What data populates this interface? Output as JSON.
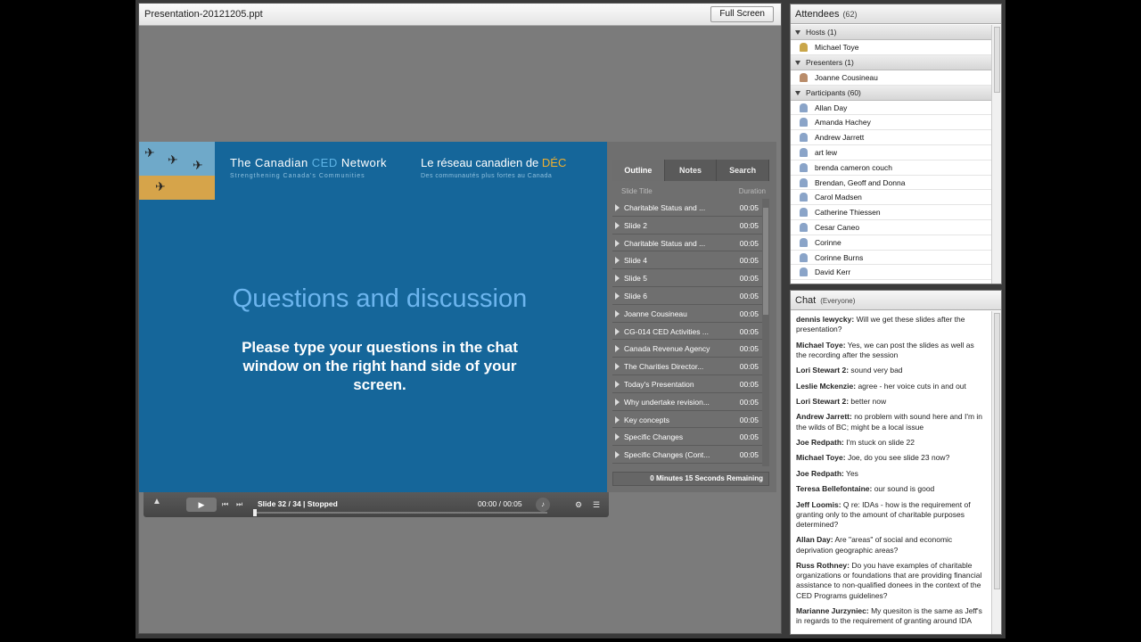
{
  "presentation": {
    "file_title": "Presentation-20121205.ppt",
    "full_screen_label": "Full Screen",
    "slide": {
      "network_en_prefix": "The Canadian ",
      "network_en_ced": "CED",
      "network_en_suffix": " Network",
      "network_fr_prefix": "Le réseau canadien de ",
      "network_fr_dec": "DÉC",
      "tagline_en": "Strengthening Canada's Communities",
      "tagline_fr": "Des communautés plus fortes au Canada",
      "heading": "Questions and discussion",
      "body": "Please type your questions in the chat window on the right hand side of your screen."
    },
    "outline": {
      "tabs": [
        "Outline",
        "Notes",
        "Search"
      ],
      "active_tab": "Outline",
      "col_title": "Slide Title",
      "col_duration": "Duration",
      "rows": [
        {
          "title": "Charitable Status and ...",
          "duration": "00:05"
        },
        {
          "title": "Slide 2",
          "duration": "00:05"
        },
        {
          "title": "Charitable Status and ...",
          "duration": "00:05"
        },
        {
          "title": "Slide 4",
          "duration": "00:05"
        },
        {
          "title": "Slide 5",
          "duration": "00:05"
        },
        {
          "title": "Slide 6",
          "duration": "00:05"
        },
        {
          "title": "Joanne Cousineau",
          "duration": "00:05"
        },
        {
          "title": "CG-014 CED Activities ...",
          "duration": "00:05"
        },
        {
          "title": "Canada Revenue Agency",
          "duration": "00:05"
        },
        {
          "title": "The Charities Director...",
          "duration": "00:05"
        },
        {
          "title": "Today's Presentation",
          "duration": "00:05"
        },
        {
          "title": "Why undertake revision...",
          "duration": "00:05"
        },
        {
          "title": "Key concepts",
          "duration": "00:05"
        },
        {
          "title": "Specific Changes",
          "duration": "00:05"
        },
        {
          "title": "Specific Changes (Cont...",
          "duration": "00:05"
        }
      ],
      "remaining": "0 Minutes 15 Seconds Remaining"
    },
    "controls": {
      "slide_status": "Slide 32 / 34 | Stopped",
      "timecode": "00:00 / 00:05",
      "adobe_label": "Adobe"
    }
  },
  "attendees": {
    "title": "Attendees",
    "count": "(62)",
    "hosts_label": "Hosts (1)",
    "hosts": [
      "Michael Toye"
    ],
    "presenters_label": "Presenters (1)",
    "presenters": [
      "Joanne Cousineau"
    ],
    "participants_label": "Participants (60)",
    "participants": [
      "Allan Day",
      "Amanda Hachey",
      "Andrew Jarrett",
      "art lew",
      "brenda cameron couch",
      "Brendan, Geoff and Donna",
      "Carol Madsen",
      "Catherine Thiessen",
      "Cesar Caneo",
      "Corinne",
      "Corinne Burns",
      "David Kerr"
    ]
  },
  "chat": {
    "title": "Chat",
    "scope": "(Everyone)",
    "messages": [
      {
        "sender": "dennis lewycky:",
        "text": " Will we get these slides after the presentation?"
      },
      {
        "sender": "Michael Toye:",
        "text": " Yes, we can post the slides as well as the recording after the session"
      },
      {
        "sender": "Lori Stewart 2:",
        "text": " sound very bad"
      },
      {
        "sender": "Leslie Mckenzie:",
        "text": " agree - her voice cuts in and out"
      },
      {
        "sender": "Lori Stewart 2:",
        "text": " better now"
      },
      {
        "sender": "Andrew Jarrett:",
        "text": " no problem with sound here and I'm in the wilds of BC; might be a local issue"
      },
      {
        "sender": "Joe Redpath:",
        "text": " I'm stuck on slide 22"
      },
      {
        "sender": "Michael Toye:",
        "text": " Joe, do you see slide 23 now?"
      },
      {
        "sender": "Joe Redpath:",
        "text": " Yes"
      },
      {
        "sender": "Teresa Bellefontaine:",
        "text": " our sound is good"
      },
      {
        "sender": "Jeff Loomis:",
        "text": " Q re: IDAs - how is the requirement of granting only to the amount of charitable purposes determined?"
      },
      {
        "sender": "Allan Day:",
        "text": " Are \"areas\" of social and economic deprivation geographic areas?"
      },
      {
        "sender": "Russ Rothney:",
        "text": " Do you have examples of charitable organizations or foundations that are providing financial assistance to non-qualified donees in the context of the CED Programs guidelines?"
      },
      {
        "sender": "Marianne Jurzyniec:",
        "text": " My quesiton is the same as Jeff's in regards to the requirement of granting around IDA"
      }
    ]
  },
  "colors": {
    "slide_bg": "#15669a",
    "heading": "#6cb5ee",
    "ced_accent": "#5fb4e6",
    "dec_accent": "#f0b030"
  }
}
